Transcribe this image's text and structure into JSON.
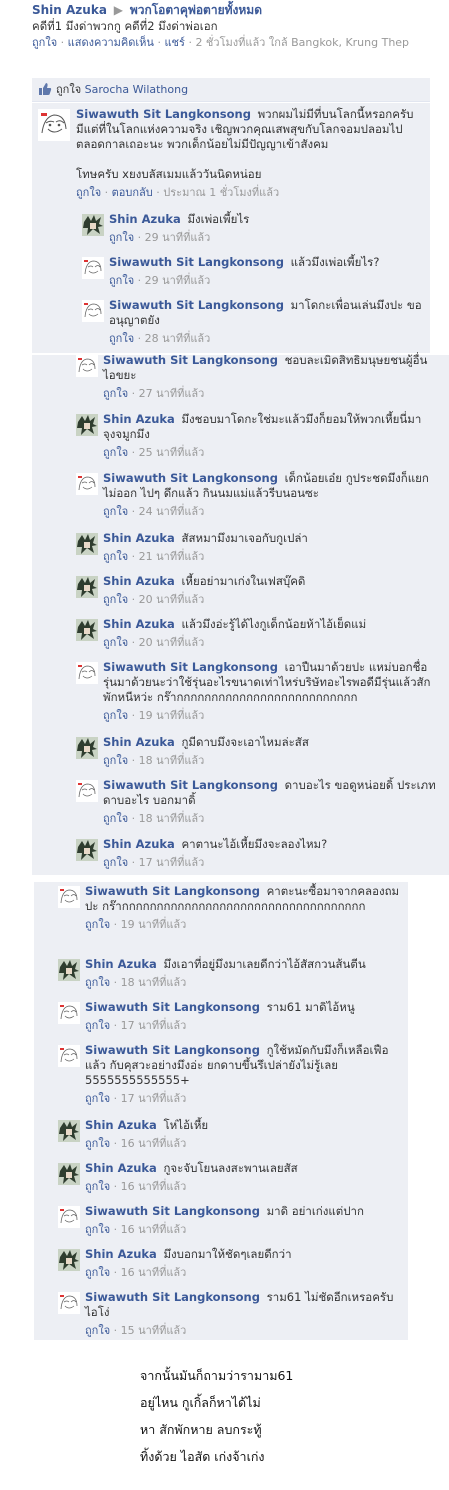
{
  "post": {
    "author": "Shin Azuka",
    "arrow": "▶",
    "group": "พวกโอตาคุพ่อตายทั้งหมด",
    "text": "คดีที่1 มึงด่าพวกกู คดีที่2 มึงด่าพ่อเอก",
    "meta_like": "ถูกใจ",
    "meta_comment": "แสดงความคิดเห็น",
    "meta_share": "แชร์",
    "meta_time": "2 ชั่วโมงที่แล้ว ใกล้ Bangkok, Krung Thep",
    "sep": "·"
  },
  "likes": {
    "icon": "thumbs-up-icon",
    "label": "ถูกใจ",
    "name": "Sarocha Wilathong"
  },
  "first_comment": {
    "name": "Siwawuth Sit Langkonsong",
    "text": "พวกผมไม่มีที่บนโลกนี้หรอกครับ มีแต่ที่ในโลกแห่งความจริง เชิญพวกคุณเสพสุขกับโลกจอมปลอมไปตลอดกาลเถอะนะ พวกเด็กน้อยไม่มีปัญญาเข้าสังคม",
    "text2": "โทษครับ xยงบลัสเมมแล้ววันนิดหน่อย",
    "like": "ถูกใจ",
    "reply": "ตอบกลับ",
    "time": "ประมาณ 1 ชั่วโมงที่แล้ว"
  },
  "comments": [
    {
      "name": "Shin Azuka",
      "text": "มึงเพ่อเพี้ยไร",
      "like": "ถูกใจ",
      "time": "29 นาทีที่แล้ว",
      "avatar": "anime-avatar"
    },
    {
      "name": "Siwawuth Sit Langkonsong",
      "text": "แล้วมึงเพ่อเพี้ยไร?",
      "like": "ถูกใจ",
      "time": "29 นาทีที่แล้ว",
      "avatar": "sketch-avatar"
    },
    {
      "name": "Siwawuth Sit Langkonsong",
      "text": "มาโดกะเพื่อนเล่นมึงปะ ขออนุญาตยัง",
      "like": "ถูกใจ",
      "time": "28 นาทีที่แล้ว",
      "avatar": "sketch-avatar"
    },
    {
      "name": "Siwawuth Sit Langkonsong",
      "text": "ชอบละเมิดสิทธิมนุษยชนผู้อื่น ไอขยะ",
      "like": "ถูกใจ",
      "time": "27 นาทีที่แล้ว",
      "avatar": "sketch-avatar"
    },
    {
      "name": "Shin Azuka",
      "text": "มึงชอบมาโดกะใช่มะแล้วมึงก็ยอมให้พวกเหี้ยนี่มาจุงจมูกมึง",
      "like": "ถูกใจ",
      "time": "25 นาทีที่แล้ว",
      "avatar": "anime-avatar"
    },
    {
      "name": "Siwawuth Sit Langkonsong",
      "text": "เด็กน้อยเอ๋ย กูประชดมึงก็แยกไม่ออก ไปๆ ดึกแล้ว กินนมแม่แล้วรีบนอนซะ",
      "like": "ถูกใจ",
      "time": "24 นาทีที่แล้ว",
      "avatar": "sketch-avatar"
    },
    {
      "name": "Shin Azuka",
      "text": "สัสหมามึงมาเจอกับกูเปล่า",
      "like": "ถูกใจ",
      "time": "21 นาทีที่แล้ว",
      "avatar": "anime-avatar"
    },
    {
      "name": "Shin Azuka",
      "text": "เหี้ยอย่ามาเก่งในเฟสบุ๊คดิ",
      "like": "ถูกใจ",
      "time": "20 นาทีที่แล้ว",
      "avatar": "anime-avatar"
    },
    {
      "name": "Shin Azuka",
      "text": "แล้วมึงอ่ะรู้ได้ไงกูเด็กน้อยห้าไอ้เย็ดแม่",
      "like": "ถูกใจ",
      "time": "20 นาทีที่แล้ว",
      "avatar": "anime-avatar"
    },
    {
      "name": "Siwawuth Sit Langkonsong",
      "text": "เอาปืนมาด้วยปะ แหม่บอกชื่อรุ่นมาด้วยนะว่าใช้รุ่นอะไรขนาดเท่าไหร่บริษัทอะไรพอดีมีรุ่นแล้วสักพักหนีหว่ะ กร๊ากกกกกกกกกกกกกกกกกกกกกกกกกก",
      "like": "ถูกใจ",
      "time": "19 นาทีที่แล้ว",
      "avatar": "sketch-avatar"
    },
    {
      "name": "Shin Azuka",
      "text": "กูมีดาบมึงจะเอาไหมล่ะสัส",
      "like": "ถูกใจ",
      "time": "18 นาทีที่แล้ว",
      "avatar": "anime-avatar"
    },
    {
      "name": "Siwawuth Sit Langkonsong",
      "text": "ดาบอะไร ขอดูหน่อยดิ้ ประเภทดาบอะไร บอกมาดิ้",
      "like": "ถูกใจ",
      "time": "18 นาทีที่แล้ว",
      "avatar": "sketch-avatar"
    },
    {
      "name": "Shin Azuka",
      "text": "คาตานะไอ้เหี้ยมึงจะลองไหม?",
      "like": "ถูกใจ",
      "time": "17 นาทีที่แล้ว",
      "avatar": "anime-avatar"
    },
    {
      "name": "Siwawuth Sit Langkonsong",
      "text": "คาตะนะซื้อมาจากคลองถมปะ กร๊ากกกกกกกกกกกกกกกกกกกกกกกกกกกกกกกกกกก",
      "like": "ถูกใจ",
      "time": "19 นาทีที่แล้ว",
      "avatar": "sketch-avatar"
    },
    {
      "name": "Shin Azuka",
      "text": "มึงเอาที่อยู่มึงมาเลยดีกว่าไอ้สัสกวนส้นตีน",
      "like": "ถูกใจ",
      "time": "18 นาทีที่แล้ว",
      "avatar": "anime-avatar"
    },
    {
      "name": "Siwawuth Sit Langkonsong",
      "text": "ราม61 มาดิไอ้หนู",
      "like": "ถูกใจ",
      "time": "17 นาทีที่แล้ว",
      "avatar": "sketch-avatar"
    },
    {
      "name": "Siwawuth Sit Langkonsong",
      "text": "กูใช้หมัดกับมึงก็เหลือเฟือแล้ว กับคุสวะอย่างมึงอ่ะ ยกดาบขึ้นรึเปล่ายังไม่รู้เลย 5555555555555+",
      "like": "ถูกใจ",
      "time": "17 นาทีที่แล้ว",
      "avatar": "sketch-avatar"
    },
    {
      "name": "Shin Azuka",
      "text": "โห่ไอ้เหี้ย",
      "like": "ถูกใจ",
      "time": "16 นาทีที่แล้ว",
      "avatar": "anime-avatar"
    },
    {
      "name": "Shin Azuka",
      "text": "กูจะจับโยนลงสะพานเลยสัส",
      "like": "ถูกใจ",
      "time": "16 นาทีที่แล้ว",
      "avatar": "anime-avatar"
    },
    {
      "name": "Siwawuth Sit Langkonsong",
      "text": "มาดิ อย่าเก่งแต่ปาก",
      "like": "ถูกใจ",
      "time": "16 นาทีที่แล้ว",
      "avatar": "sketch-avatar"
    },
    {
      "name": "Shin Azuka",
      "text": "มึงบอกมาให้ชัดๆเลยดีกว่า",
      "like": "ถูกใจ",
      "time": "16 นาทีที่แล้ว",
      "avatar": "anime-avatar"
    },
    {
      "name": "Siwawuth Sit Langkonsong",
      "text": "ราม61 ไม่ชัดอีกเหรอครับไอโง่",
      "like": "ถูกใจ",
      "time": "15 นาทีที่แล้ว",
      "avatar": "sketch-avatar"
    }
  ],
  "footer": {
    "lines": [
      "จากนั้นมันก็ถามว่ารามาม61",
      "อยู่ไหน   กูเกิ้ลก็หาได้ไม่",
      "หา   สักพักหาย   ลบกระทู้",
      "ทิ้งด้วย    ไอสัด   เก่งจ้าเก่ง"
    ]
  }
}
